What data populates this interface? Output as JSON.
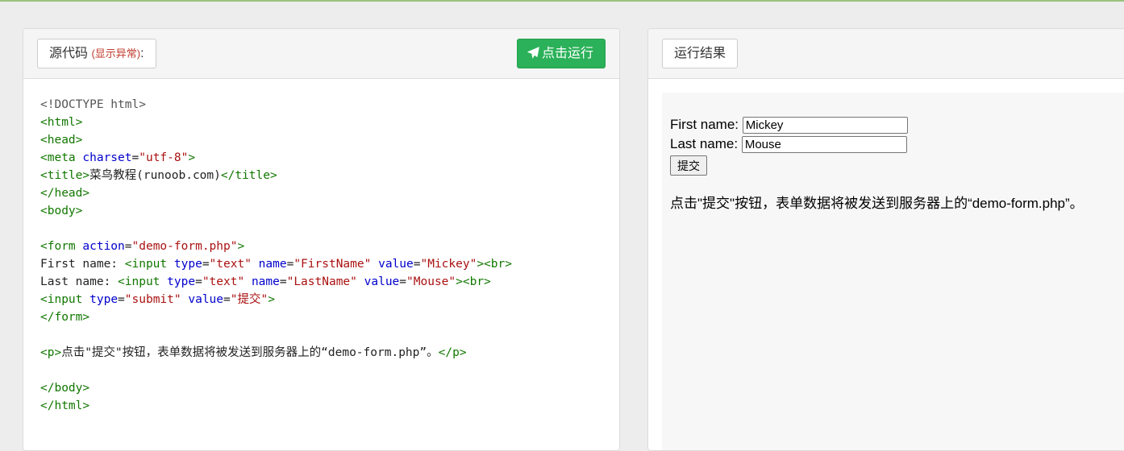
{
  "source_panel": {
    "title": "源代码",
    "hint": "(显示异常)",
    "colon": ":",
    "run_button": "点击运行"
  },
  "code": {
    "l1": "<!DOCTYPE html>",
    "l2": "<html>",
    "l3": "<head>",
    "l4_tag": "<meta",
    "l4_attr": "charset",
    "l4_val": "\"utf-8\"",
    "l5_open": "<title>",
    "l5_text": "菜鸟教程(runoob.com)",
    "l5_close": "</title>",
    "l6": "</head>",
    "l7": "<body>",
    "l9_tag": "<form",
    "l9_attr": "action",
    "l9_val": "\"demo-form.php\"",
    "l10_text": "First name: ",
    "l10_val_type": "\"text\"",
    "l10_val_name": "\"FirstName\"",
    "l10_val_value": "\"Mickey\"",
    "l11_text": "Last name: ",
    "l11_val_type": "\"text\"",
    "l11_val_name": "\"LastName\"",
    "l11_val_value": "\"Mouse\"",
    "l12_val_type": "\"submit\"",
    "l12_val_value": "\"提交\"",
    "l13": "</form>",
    "l15_open": "<p>",
    "l15_text": "点击\"提交\"按钮，表单数据将被发送到服务器上的“demo-form.php”。",
    "l15_close": "</p>",
    "l17": "</body>",
    "l18": "</html>",
    "tag_input": "<input",
    "attr_type": "type",
    "attr_name": "name",
    "attr_value": "value",
    "tag_br": "><br>",
    "gt": ">",
    "eq": "="
  },
  "result_panel": {
    "title": "运行结果",
    "first_label": "First name:",
    "first_value": "Mickey",
    "last_label": "Last name:",
    "last_value": "Mouse",
    "submit_label": "提交",
    "paragraph": "点击\"提交\"按钮，表单数据将被发送到服务器上的“demo-form.php”。"
  },
  "colors": {
    "run_button": "#2bb159",
    "tag": "#117700",
    "attribute": "#0000cc",
    "string": "#aa1111"
  }
}
